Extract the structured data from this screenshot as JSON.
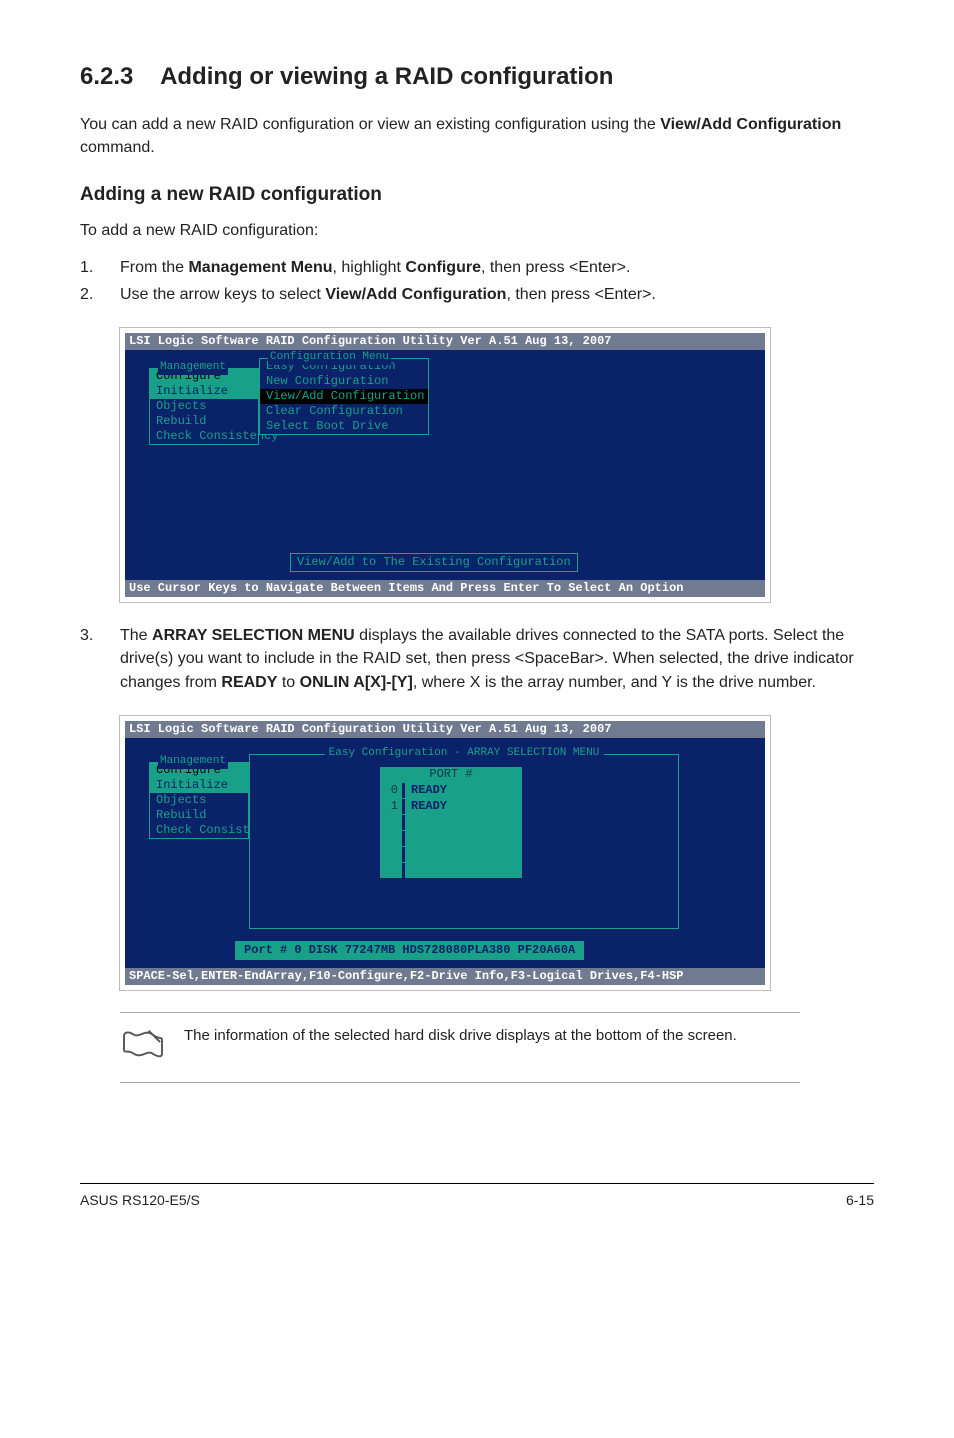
{
  "section": {
    "number": "6.2.3",
    "title": "Adding or viewing a RAID configuration",
    "intro_pre": "You can add a new RAID configuration or view an existing configuration using the ",
    "intro_bold": "View/Add Configuration",
    "intro_post": " command."
  },
  "subheading": "Adding a new RAID configuration",
  "sub_intro": "To add a new RAID configuration:",
  "step1": {
    "num": "1.",
    "pre": "From the ",
    "b1": "Management Menu",
    "mid": ", highlight ",
    "b2": "Configure",
    "post": ", then press <Enter>."
  },
  "step2": {
    "num": "2.",
    "pre": "Use the arrow keys to select ",
    "b1": "View/Add Configuration",
    "post": ", then press <Enter>."
  },
  "term1": {
    "title": "LSI Logic Software RAID Configuration Utility Ver A.51 Aug 13, 2007",
    "mgmt_label": "Management",
    "mgmt_items": [
      "Configure",
      "Initialize",
      "Objects",
      "Rebuild",
      "Check Consistency"
    ],
    "cfg_label": "Configuration Menu",
    "cfg_items": [
      "Easy Configuration",
      "New Configuration",
      "View/Add Configuration",
      "Clear Configuration",
      "Select Boot Drive"
    ],
    "hint": "View/Add to The Existing Configuration",
    "footer": "Use Cursor Keys to Navigate Between Items And Press Enter To Select An Option"
  },
  "step3": {
    "num": "3.",
    "pre": "The ",
    "b1": "ARRAY SELECTION MENU",
    "mid1": " displays the available drives connected to the SATA ports. Select the drive(s) you want to include in the RAID set, then press <SpaceBar>. When selected, the drive indicator changes from ",
    "b2": "READY",
    "mid2": " to ",
    "b3": "ONLIN A[X]-[Y]",
    "post": ", where X is the array number, and Y is the drive number."
  },
  "term2": {
    "title": "LSI Logic Software RAID Configuration Utility Ver A.51 Aug 13, 2007",
    "mgmt_label": "Management",
    "mgmt_items": [
      "Configure",
      "Initialize",
      "Objects",
      "Rebuild",
      "Check Consist"
    ],
    "sel_label": "Easy Configuration - ARRAY SELECTION MENU",
    "port_header": "PORT #",
    "ports": [
      {
        "n": "0",
        "v": "READY"
      },
      {
        "n": "1",
        "v": "READY"
      }
    ],
    "status": "Port # 0 DISK   77247MB   HDS728080PLA380   PF20A60A",
    "footer": "SPACE-Sel,ENTER-EndArray,F10-Configure,F2-Drive Info,F3-Logical Drives,F4-HSP"
  },
  "note": "The information of the selected hard disk drive displays at the bottom of the screen.",
  "footer": {
    "left": "ASUS RS120-E5/S",
    "right": "6-15"
  }
}
